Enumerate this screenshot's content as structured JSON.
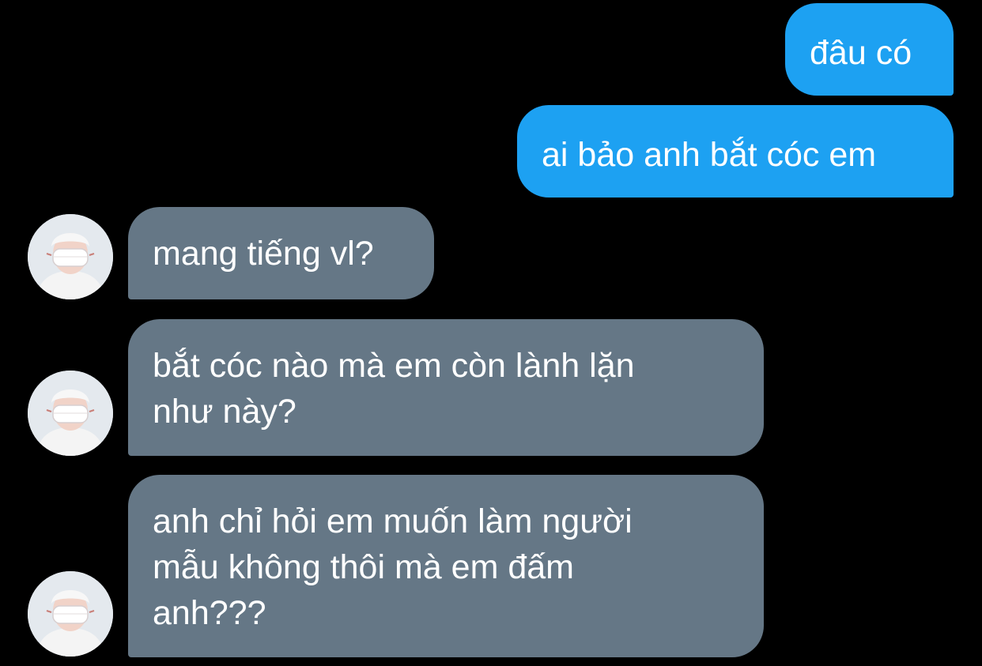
{
  "conversation": {
    "messages": [
      {
        "sender": "me",
        "text": "đâu có"
      },
      {
        "sender": "me",
        "text": "ai bảo anh bắt cóc em"
      },
      {
        "sender": "other",
        "text": "mang tiếng vl?"
      },
      {
        "sender": "other",
        "text": "bắt cóc nào mà em còn lành lặn\nnhư này?"
      },
      {
        "sender": "other",
        "text": "anh chỉ hỏi em muốn làm người\nmẫu không thôi mà em đấm\nanh???"
      }
    ]
  },
  "colors": {
    "background": "#000000",
    "sent_bubble": "#1da1f2",
    "received_bubble": "#657786",
    "text": "#ffffff"
  },
  "icons": {
    "avatar": "avatar-masked-person"
  }
}
